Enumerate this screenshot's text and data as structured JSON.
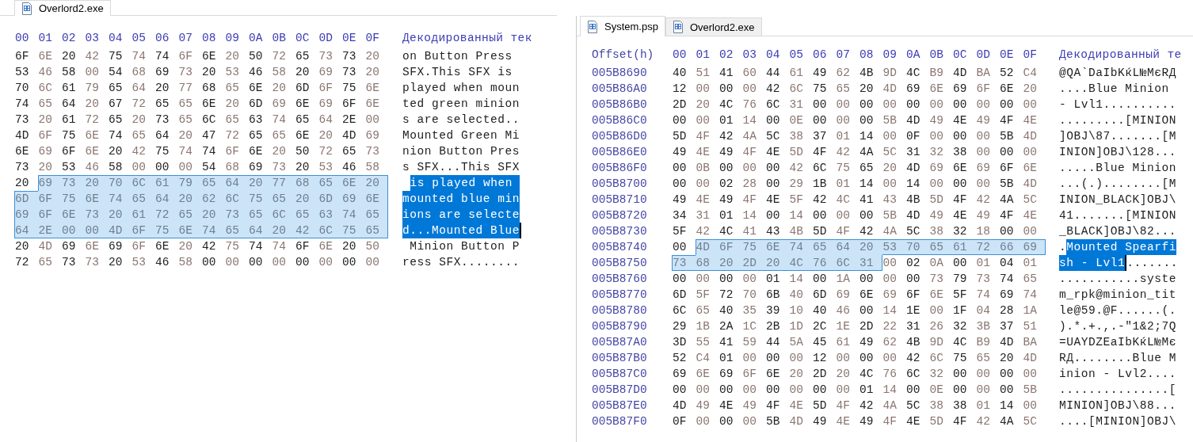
{
  "panels": [
    {
      "tabs": [
        {
          "label": "Overlord2.exe",
          "selected": true
        }
      ],
      "columns": [
        "00",
        "01",
        "02",
        "03",
        "04",
        "05",
        "06",
        "07",
        "08",
        "09",
        "0A",
        "0B",
        "0C",
        "0D",
        "0E",
        "0F"
      ],
      "text_header": "Декодированный тек",
      "rows": [
        {
          "bytes": [
            "6F",
            "6E",
            "20",
            "42",
            "75",
            "74",
            "74",
            "6F",
            "6E",
            "20",
            "50",
            "72",
            "65",
            "73",
            "73",
            "20"
          ],
          "selection": [
            false,
            false,
            false,
            false,
            false,
            false,
            false,
            false,
            false,
            false,
            false,
            false,
            false,
            false,
            false,
            false
          ],
          "text": [
            {
              "text": "on Button Press ",
              "selected": false
            }
          ],
          "caret": false
        },
        {
          "bytes": [
            "53",
            "46",
            "58",
            "00",
            "54",
            "68",
            "69",
            "73",
            "20",
            "53",
            "46",
            "58",
            "20",
            "69",
            "73",
            "20"
          ],
          "selection": [
            false,
            false,
            false,
            false,
            false,
            false,
            false,
            false,
            false,
            false,
            false,
            false,
            false,
            false,
            false,
            false
          ],
          "text": [
            {
              "text": "SFX.This SFX is ",
              "selected": false
            }
          ],
          "caret": false
        },
        {
          "bytes": [
            "70",
            "6C",
            "61",
            "79",
            "65",
            "64",
            "20",
            "77",
            "68",
            "65",
            "6E",
            "20",
            "6D",
            "6F",
            "75",
            "6E"
          ],
          "selection": [
            false,
            false,
            false,
            false,
            false,
            false,
            false,
            false,
            false,
            false,
            false,
            false,
            false,
            false,
            false,
            false
          ],
          "text": [
            {
              "text": "played when moun",
              "selected": false
            }
          ],
          "caret": false
        },
        {
          "bytes": [
            "74",
            "65",
            "64",
            "20",
            "67",
            "72",
            "65",
            "65",
            "6E",
            "20",
            "6D",
            "69",
            "6E",
            "69",
            "6F",
            "6E"
          ],
          "selection": [
            false,
            false,
            false,
            false,
            false,
            false,
            false,
            false,
            false,
            false,
            false,
            false,
            false,
            false,
            false,
            false
          ],
          "text": [
            {
              "text": "ted green minion",
              "selected": false
            }
          ],
          "caret": false
        },
        {
          "bytes": [
            "73",
            "20",
            "61",
            "72",
            "65",
            "20",
            "73",
            "65",
            "6C",
            "65",
            "63",
            "74",
            "65",
            "64",
            "2E",
            "00"
          ],
          "selection": [
            false,
            false,
            false,
            false,
            false,
            false,
            false,
            false,
            false,
            false,
            false,
            false,
            false,
            false,
            false,
            false
          ],
          "text": [
            {
              "text": "s are selected..",
              "selected": false
            }
          ],
          "caret": false
        },
        {
          "bytes": [
            "4D",
            "6F",
            "75",
            "6E",
            "74",
            "65",
            "64",
            "20",
            "47",
            "72",
            "65",
            "65",
            "6E",
            "20",
            "4D",
            "69"
          ],
          "selection": [
            false,
            false,
            false,
            false,
            false,
            false,
            false,
            false,
            false,
            false,
            false,
            false,
            false,
            false,
            false,
            false
          ],
          "text": [
            {
              "text": "Mounted Green Mi",
              "selected": false
            }
          ],
          "caret": false
        },
        {
          "bytes": [
            "6E",
            "69",
            "6F",
            "6E",
            "20",
            "42",
            "75",
            "74",
            "74",
            "6F",
            "6E",
            "20",
            "50",
            "72",
            "65",
            "73"
          ],
          "selection": [
            false,
            false,
            false,
            false,
            false,
            false,
            false,
            false,
            false,
            false,
            false,
            false,
            false,
            false,
            false,
            false
          ],
          "text": [
            {
              "text": "nion Button Pres",
              "selected": false
            }
          ],
          "caret": false
        },
        {
          "bytes": [
            "73",
            "20",
            "53",
            "46",
            "58",
            "00",
            "00",
            "00",
            "54",
            "68",
            "69",
            "73",
            "20",
            "53",
            "46",
            "58"
          ],
          "selection": [
            false,
            false,
            false,
            false,
            false,
            false,
            false,
            false,
            false,
            false,
            false,
            false,
            false,
            false,
            false,
            false
          ],
          "text": [
            {
              "text": "s SFX...This SFX",
              "selected": false
            }
          ],
          "caret": false
        },
        {
          "bytes": [
            "20",
            "69",
            "73",
            "20",
            "70",
            "6C",
            "61",
            "79",
            "65",
            "64",
            "20",
            "77",
            "68",
            "65",
            "6E",
            "20"
          ],
          "selection": [
            false,
            true,
            true,
            true,
            true,
            true,
            true,
            true,
            true,
            true,
            true,
            true,
            true,
            true,
            true,
            true
          ],
          "text": [
            {
              "text": "is played when ",
              "selected": true
            }
          ],
          "caret": false
        },
        {
          "bytes": [
            "6D",
            "6F",
            "75",
            "6E",
            "74",
            "65",
            "64",
            "20",
            "62",
            "6C",
            "75",
            "65",
            "20",
            "6D",
            "69",
            "6E"
          ],
          "selection": [
            true,
            true,
            true,
            true,
            true,
            true,
            true,
            true,
            true,
            true,
            true,
            true,
            true,
            true,
            true,
            true
          ],
          "text": [
            {
              "text": "mounted blue min",
              "selected": true
            }
          ],
          "caret": false
        },
        {
          "bytes": [
            "69",
            "6F",
            "6E",
            "73",
            "20",
            "61",
            "72",
            "65",
            "20",
            "73",
            "65",
            "6C",
            "65",
            "63",
            "74",
            "65"
          ],
          "selection": [
            true,
            true,
            true,
            true,
            true,
            true,
            true,
            true,
            true,
            true,
            true,
            true,
            true,
            true,
            true,
            true
          ],
          "text": [
            {
              "text": "ions are selecte",
              "selected": true
            }
          ],
          "caret": false
        },
        {
          "bytes": [
            "64",
            "2E",
            "00",
            "00",
            "4D",
            "6F",
            "75",
            "6E",
            "74",
            "65",
            "64",
            "20",
            "42",
            "6C",
            "75",
            "65"
          ],
          "selection": [
            true,
            true,
            true,
            true,
            true,
            true,
            true,
            true,
            true,
            true,
            true,
            true,
            true,
            true,
            true,
            true
          ],
          "text": [
            {
              "text": "d...Mounted Blue",
              "selected": true
            }
          ],
          "caret": true
        },
        {
          "bytes": [
            "20",
            "4D",
            "69",
            "6E",
            "69",
            "6F",
            "6E",
            "20",
            "42",
            "75",
            "74",
            "74",
            "6F",
            "6E",
            "20",
            "50"
          ],
          "selection": [
            false,
            false,
            false,
            false,
            false,
            false,
            false,
            false,
            false,
            false,
            false,
            false,
            false,
            false,
            false,
            false
          ],
          "text": [
            {
              "text": " Minion Button P",
              "selected": false
            }
          ],
          "caret": false
        },
        {
          "bytes": [
            "72",
            "65",
            "73",
            "73",
            "20",
            "53",
            "46",
            "58",
            "00",
            "00",
            "00",
            "00",
            "00",
            "00",
            "00",
            "00"
          ],
          "selection": [
            false,
            false,
            false,
            false,
            false,
            false,
            false,
            false,
            false,
            false,
            false,
            false,
            false,
            false,
            false,
            false
          ],
          "text": [
            {
              "text": "ress SFX........",
              "selected": false
            }
          ],
          "caret": false
        }
      ]
    },
    {
      "tabs": [
        {
          "label": "System.psp",
          "selected": true
        },
        {
          "label": "Overlord2.exe",
          "selected": false
        }
      ],
      "offset_header": "Offset(h)",
      "columns": [
        "00",
        "01",
        "02",
        "03",
        "04",
        "05",
        "06",
        "07",
        "08",
        "09",
        "0A",
        "0B",
        "0C",
        "0D",
        "0E",
        "0F"
      ],
      "text_header": "Декодированный те",
      "rows": [
        {
          "offset": "005B8690",
          "bytes": [
            "40",
            "51",
            "41",
            "60",
            "44",
            "61",
            "49",
            "62",
            "4B",
            "9D",
            "4C",
            "B9",
            "4D",
            "BA",
            "52",
            "C4"
          ],
          "selection": [
            false,
            false,
            false,
            false,
            false,
            false,
            false,
            false,
            false,
            false,
            false,
            false,
            false,
            false,
            false,
            false
          ],
          "text": [
            {
              "text": "@QA`DaIbKќL№MєRД",
              "selected": false
            }
          ],
          "caret": false
        },
        {
          "offset": "005B86A0",
          "bytes": [
            "12",
            "00",
            "00",
            "00",
            "42",
            "6C",
            "75",
            "65",
            "20",
            "4D",
            "69",
            "6E",
            "69",
            "6F",
            "6E",
            "20"
          ],
          "selection": [
            false,
            false,
            false,
            false,
            false,
            false,
            false,
            false,
            false,
            false,
            false,
            false,
            false,
            false,
            false,
            false
          ],
          "text": [
            {
              "text": "....Blue Minion ",
              "selected": false
            }
          ],
          "caret": false
        },
        {
          "offset": "005B86B0",
          "bytes": [
            "2D",
            "20",
            "4C",
            "76",
            "6C",
            "31",
            "00",
            "00",
            "00",
            "00",
            "00",
            "00",
            "00",
            "00",
            "00",
            "00"
          ],
          "selection": [
            false,
            false,
            false,
            false,
            false,
            false,
            false,
            false,
            false,
            false,
            false,
            false,
            false,
            false,
            false,
            false
          ],
          "text": [
            {
              "text": "- Lvl1..........",
              "selected": false
            }
          ],
          "caret": false
        },
        {
          "offset": "005B86C0",
          "bytes": [
            "00",
            "00",
            "01",
            "14",
            "00",
            "0E",
            "00",
            "00",
            "00",
            "5B",
            "4D",
            "49",
            "4E",
            "49",
            "4F",
            "4E"
          ],
          "selection": [
            false,
            false,
            false,
            false,
            false,
            false,
            false,
            false,
            false,
            false,
            false,
            false,
            false,
            false,
            false,
            false
          ],
          "text": [
            {
              "text": ".........[MINION",
              "selected": false
            }
          ],
          "caret": false
        },
        {
          "offset": "005B86D0",
          "bytes": [
            "5D",
            "4F",
            "42",
            "4A",
            "5C",
            "38",
            "37",
            "01",
            "14",
            "00",
            "0F",
            "00",
            "00",
            "00",
            "5B",
            "4D"
          ],
          "selection": [
            false,
            false,
            false,
            false,
            false,
            false,
            false,
            false,
            false,
            false,
            false,
            false,
            false,
            false,
            false,
            false
          ],
          "text": [
            {
              "text": "]OBJ\\87.......[M",
              "selected": false
            }
          ],
          "caret": false
        },
        {
          "offset": "005B86E0",
          "bytes": [
            "49",
            "4E",
            "49",
            "4F",
            "4E",
            "5D",
            "4F",
            "42",
            "4A",
            "5C",
            "31",
            "32",
            "38",
            "00",
            "00",
            "00"
          ],
          "selection": [
            false,
            false,
            false,
            false,
            false,
            false,
            false,
            false,
            false,
            false,
            false,
            false,
            false,
            false,
            false,
            false
          ],
          "text": [
            {
              "text": "INION]OBJ\\128...",
              "selected": false
            }
          ],
          "caret": false
        },
        {
          "offset": "005B86F0",
          "bytes": [
            "00",
            "0B",
            "00",
            "00",
            "00",
            "42",
            "6C",
            "75",
            "65",
            "20",
            "4D",
            "69",
            "6E",
            "69",
            "6F",
            "6E"
          ],
          "selection": [
            false,
            false,
            false,
            false,
            false,
            false,
            false,
            false,
            false,
            false,
            false,
            false,
            false,
            false,
            false,
            false
          ],
          "text": [
            {
              "text": ".....Blue Minion",
              "selected": false
            }
          ],
          "caret": false
        },
        {
          "offset": "005B8700",
          "bytes": [
            "00",
            "00",
            "02",
            "28",
            "00",
            "29",
            "1B",
            "01",
            "14",
            "00",
            "14",
            "00",
            "00",
            "00",
            "5B",
            "4D"
          ],
          "selection": [
            false,
            false,
            false,
            false,
            false,
            false,
            false,
            false,
            false,
            false,
            false,
            false,
            false,
            false,
            false,
            false
          ],
          "text": [
            {
              "text": "...(.)........[M",
              "selected": false
            }
          ],
          "caret": false
        },
        {
          "offset": "005B8710",
          "bytes": [
            "49",
            "4E",
            "49",
            "4F",
            "4E",
            "5F",
            "42",
            "4C",
            "41",
            "43",
            "4B",
            "5D",
            "4F",
            "42",
            "4A",
            "5C"
          ],
          "selection": [
            false,
            false,
            false,
            false,
            false,
            false,
            false,
            false,
            false,
            false,
            false,
            false,
            false,
            false,
            false,
            false
          ],
          "text": [
            {
              "text": "INION_BLACK]OBJ\\",
              "selected": false
            }
          ],
          "caret": false
        },
        {
          "offset": "005B8720",
          "bytes": [
            "34",
            "31",
            "01",
            "14",
            "00",
            "14",
            "00",
            "00",
            "00",
            "5B",
            "4D",
            "49",
            "4E",
            "49",
            "4F",
            "4E"
          ],
          "selection": [
            false,
            false,
            false,
            false,
            false,
            false,
            false,
            false,
            false,
            false,
            false,
            false,
            false,
            false,
            false,
            false
          ],
          "text": [
            {
              "text": "41.......[MINION",
              "selected": false
            }
          ],
          "caret": false
        },
        {
          "offset": "005B8730",
          "bytes": [
            "5F",
            "42",
            "4C",
            "41",
            "43",
            "4B",
            "5D",
            "4F",
            "42",
            "4A",
            "5C",
            "38",
            "32",
            "18",
            "00",
            "00"
          ],
          "selection": [
            false,
            false,
            false,
            false,
            false,
            false,
            false,
            false,
            false,
            false,
            false,
            false,
            false,
            false,
            false,
            false
          ],
          "text": [
            {
              "text": "_BLACK]OBJ\\82...",
              "selected": false
            }
          ],
          "caret": false
        },
        {
          "offset": "005B8740",
          "bytes": [
            "00",
            "4D",
            "6F",
            "75",
            "6E",
            "74",
            "65",
            "64",
            "20",
            "53",
            "70",
            "65",
            "61",
            "72",
            "66",
            "69"
          ],
          "selection": [
            false,
            true,
            true,
            true,
            true,
            true,
            true,
            true,
            true,
            true,
            true,
            true,
            true,
            true,
            true,
            true
          ],
          "text": [
            {
              "text": ".",
              "selected": false
            },
            {
              "text": "Mounted Spearfi",
              "selected": true
            }
          ],
          "caret": false
        },
        {
          "offset": "005B8750",
          "bytes": [
            "73",
            "68",
            "20",
            "2D",
            "20",
            "4C",
            "76",
            "6C",
            "31",
            "00",
            "02",
            "0A",
            "00",
            "01",
            "04",
            "01"
          ],
          "selection": [
            true,
            true,
            true,
            true,
            true,
            true,
            true,
            true,
            true,
            false,
            false,
            false,
            false,
            false,
            false,
            false
          ],
          "text": [
            {
              "text": "sh - Lvl1",
              "selected": true
            },
            {
              "text": ".......",
              "selected": false
            }
          ],
          "caret": true
        },
        {
          "offset": "005B8760",
          "bytes": [
            "00",
            "00",
            "00",
            "00",
            "01",
            "14",
            "00",
            "1A",
            "00",
            "00",
            "00",
            "73",
            "79",
            "73",
            "74",
            "65"
          ],
          "selection": [
            false,
            false,
            false,
            false,
            false,
            false,
            false,
            false,
            false,
            false,
            false,
            false,
            false,
            false,
            false,
            false
          ],
          "text": [
            {
              "text": "...........syste",
              "selected": false
            }
          ],
          "caret": false
        },
        {
          "offset": "005B8770",
          "bytes": [
            "6D",
            "5F",
            "72",
            "70",
            "6B",
            "40",
            "6D",
            "69",
            "6E",
            "69",
            "6F",
            "6E",
            "5F",
            "74",
            "69",
            "74"
          ],
          "selection": [
            false,
            false,
            false,
            false,
            false,
            false,
            false,
            false,
            false,
            false,
            false,
            false,
            false,
            false,
            false,
            false
          ],
          "text": [
            {
              "text": "m_rpk@minion_tit",
              "selected": false
            }
          ],
          "caret": false
        },
        {
          "offset": "005B8780",
          "bytes": [
            "6C",
            "65",
            "40",
            "35",
            "39",
            "10",
            "40",
            "46",
            "00",
            "14",
            "1E",
            "00",
            "1F",
            "04",
            "28",
            "1A"
          ],
          "selection": [
            false,
            false,
            false,
            false,
            false,
            false,
            false,
            false,
            false,
            false,
            false,
            false,
            false,
            false,
            false,
            false
          ],
          "text": [
            {
              "text": "le@59.@F......(.",
              "selected": false
            }
          ],
          "caret": false
        },
        {
          "offset": "005B8790",
          "bytes": [
            "29",
            "1B",
            "2A",
            "1C",
            "2B",
            "1D",
            "2C",
            "1E",
            "2D",
            "22",
            "31",
            "26",
            "32",
            "3B",
            "37",
            "51"
          ],
          "selection": [
            false,
            false,
            false,
            false,
            false,
            false,
            false,
            false,
            false,
            false,
            false,
            false,
            false,
            false,
            false,
            false
          ],
          "text": [
            {
              "text": ").*.+.,.-\"1&2;7Q",
              "selected": false
            }
          ],
          "caret": false
        },
        {
          "offset": "005B87A0",
          "bytes": [
            "3D",
            "55",
            "41",
            "59",
            "44",
            "5A",
            "45",
            "61",
            "49",
            "62",
            "4B",
            "9D",
            "4C",
            "B9",
            "4D",
            "BA"
          ],
          "selection": [
            false,
            false,
            false,
            false,
            false,
            false,
            false,
            false,
            false,
            false,
            false,
            false,
            false,
            false,
            false,
            false
          ],
          "text": [
            {
              "text": "=UAYDZEaIbKќL№Mє",
              "selected": false
            }
          ],
          "caret": false
        },
        {
          "offset": "005B87B0",
          "bytes": [
            "52",
            "C4",
            "01",
            "00",
            "00",
            "00",
            "12",
            "00",
            "00",
            "00",
            "42",
            "6C",
            "75",
            "65",
            "20",
            "4D"
          ],
          "selection": [
            false,
            false,
            false,
            false,
            false,
            false,
            false,
            false,
            false,
            false,
            false,
            false,
            false,
            false,
            false,
            false
          ],
          "text": [
            {
              "text": "RД........Blue M",
              "selected": false
            }
          ],
          "caret": false
        },
        {
          "offset": "005B87C0",
          "bytes": [
            "69",
            "6E",
            "69",
            "6F",
            "6E",
            "20",
            "2D",
            "20",
            "4C",
            "76",
            "6C",
            "32",
            "00",
            "00",
            "00",
            "00"
          ],
          "selection": [
            false,
            false,
            false,
            false,
            false,
            false,
            false,
            false,
            false,
            false,
            false,
            false,
            false,
            false,
            false,
            false
          ],
          "text": [
            {
              "text": "inion - Lvl2....",
              "selected": false
            }
          ],
          "caret": false
        },
        {
          "offset": "005B87D0",
          "bytes": [
            "00",
            "00",
            "00",
            "00",
            "00",
            "00",
            "00",
            "00",
            "01",
            "14",
            "00",
            "0E",
            "00",
            "00",
            "00",
            "5B"
          ],
          "selection": [
            false,
            false,
            false,
            false,
            false,
            false,
            false,
            false,
            false,
            false,
            false,
            false,
            false,
            false,
            false,
            false
          ],
          "text": [
            {
              "text": "...............[",
              "selected": false
            }
          ],
          "caret": false
        },
        {
          "offset": "005B87E0",
          "bytes": [
            "4D",
            "49",
            "4E",
            "49",
            "4F",
            "4E",
            "5D",
            "4F",
            "42",
            "4A",
            "5C",
            "38",
            "38",
            "01",
            "14",
            "00"
          ],
          "selection": [
            false,
            false,
            false,
            false,
            false,
            false,
            false,
            false,
            false,
            false,
            false,
            false,
            false,
            false,
            false,
            false
          ],
          "text": [
            {
              "text": "MINION]OBJ\\88...",
              "selected": false
            }
          ],
          "caret": false
        },
        {
          "offset": "005B87F0",
          "bytes": [
            "0F",
            "00",
            "00",
            "00",
            "5B",
            "4D",
            "49",
            "4E",
            "49",
            "4F",
            "4E",
            "5D",
            "4F",
            "42",
            "4A",
            "5C"
          ],
          "selection": [
            false,
            false,
            false,
            false,
            false,
            false,
            false,
            false,
            false,
            false,
            false,
            false,
            false,
            false,
            false,
            false
          ],
          "text": [
            {
              "text": "....[MINION]OBJ\\",
              "selected": false
            }
          ],
          "caret": false
        }
      ]
    }
  ]
}
